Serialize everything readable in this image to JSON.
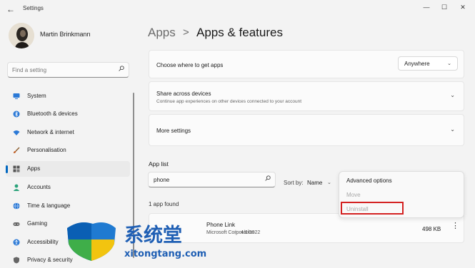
{
  "window": {
    "title": "Settings",
    "back_icon": "←",
    "minimize": "—",
    "maximize": "☐",
    "close": "✕"
  },
  "profile": {
    "name": "Martin Brinkmann"
  },
  "search": {
    "placeholder": "Find a setting",
    "icon": "search-icon"
  },
  "sidebar": {
    "items": [
      {
        "label": "System",
        "icon": "system-icon",
        "color": "#2b79d6"
      },
      {
        "label": "Bluetooth & devices",
        "icon": "bluetooth-icon",
        "color": "#2b79d6"
      },
      {
        "label": "Network & internet",
        "icon": "wifi-icon",
        "color": "#2b79d6"
      },
      {
        "label": "Personalisation",
        "icon": "brush-icon",
        "color": "#c0581c"
      },
      {
        "label": "Apps",
        "icon": "apps-icon",
        "color": "#555555",
        "active": true
      },
      {
        "label": "Accounts",
        "icon": "person-icon",
        "color": "#2aa27a"
      },
      {
        "label": "Time & language",
        "icon": "globe-icon",
        "color": "#2b79d6"
      },
      {
        "label": "Gaming",
        "icon": "gamepad-icon",
        "color": "#666666"
      },
      {
        "label": "Accessibility",
        "icon": "accessibility-icon",
        "color": "#2b79d6"
      },
      {
        "label": "Privacy & security",
        "icon": "shield-icon",
        "color": "#666666"
      }
    ]
  },
  "header": {
    "parent": "Apps",
    "separator": ">",
    "title": "Apps & features"
  },
  "settings": {
    "choose_label": "Choose where to get apps",
    "choose_value": "Anywhere",
    "share_label": "Share across devices",
    "share_sub": "Continue app experiences on other devices connected to your account",
    "more_label": "More settings"
  },
  "app_list": {
    "title": "App list",
    "search_value": "phone",
    "sort_label": "Sort by:",
    "sort_value": "Name",
    "found": "1 app found",
    "apps": [
      {
        "name": "Phone Link",
        "publisher": "Microsoft Corporation",
        "date": "4/1/2022",
        "size": "498 KB"
      }
    ]
  },
  "context_menu": {
    "items": [
      {
        "label": "Advanced options",
        "enabled": true
      },
      {
        "label": "Move",
        "enabled": false
      },
      {
        "label": "Uninstall",
        "enabled": false
      }
    ]
  },
  "watermark": {
    "text": "系统堂",
    "url": "xitongtang.com"
  },
  "colors": {
    "accent": "#0067c0",
    "highlight_box": "#d42222"
  }
}
